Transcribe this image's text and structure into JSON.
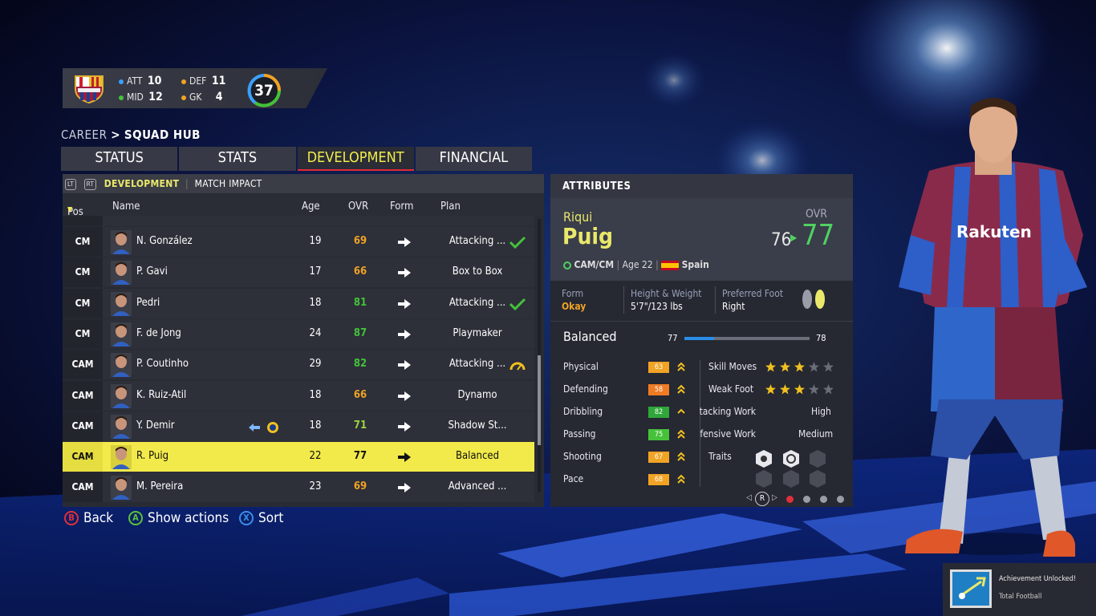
{
  "club": {
    "counts": [
      {
        "label": "ATT",
        "value": "10",
        "color": "#3aa0ff"
      },
      {
        "label": "DEF",
        "value": "11",
        "color": "#f0a325"
      },
      {
        "label": "MID",
        "value": "12",
        "color": "#44c23a"
      },
      {
        "label": "GK",
        "value": "4",
        "color": "#f0a325"
      }
    ],
    "total": "37"
  },
  "breadcrumb": {
    "root": "CAREER",
    "separator": ">",
    "current": "SQUAD HUB"
  },
  "tabs": [
    "STATUS",
    "STATS",
    "DEVELOPMENT",
    "FINANCIAL"
  ],
  "active_tab": "DEVELOPMENT",
  "subtabs": {
    "left_key": "LT",
    "right_key": "RT",
    "active": "DEVELOPMENT",
    "separator": "|",
    "other": "MATCH IMPACT"
  },
  "columns": {
    "pos": "Pos",
    "name": "Name",
    "age": "Age",
    "ovr": "OVR",
    "form": "Form",
    "plan": "Plan"
  },
  "players": [
    {
      "pos": "CM",
      "name": "N. González",
      "age": "19",
      "ovr": "69",
      "ovr_color": "org",
      "plan": "Attacking ...",
      "mark": "check"
    },
    {
      "pos": "CM",
      "name": "P. Gavi",
      "age": "17",
      "ovr": "66",
      "ovr_color": "org",
      "plan": "Box to Box",
      "mark": ""
    },
    {
      "pos": "CM",
      "name": "Pedri",
      "age": "18",
      "ovr": "81",
      "ovr_color": "grn",
      "plan": "Attacking ...",
      "mark": "check"
    },
    {
      "pos": "CM",
      "name": "F. de Jong",
      "age": "24",
      "ovr": "87",
      "ovr_color": "grn",
      "plan": "Playmaker",
      "mark": ""
    },
    {
      "pos": "CAM",
      "name": "P. Coutinho",
      "age": "29",
      "ovr": "82",
      "ovr_color": "grn",
      "plan": "Attacking ...",
      "mark": "gauge"
    },
    {
      "pos": "CAM",
      "name": "K. Ruiz-Atil",
      "age": "18",
      "ovr": "66",
      "ovr_color": "org",
      "plan": "Dynamo",
      "mark": ""
    },
    {
      "pos": "CAM",
      "name": "Y. Demir",
      "age": "18",
      "ovr": "71",
      "ovr_color": "lgrn",
      "plan": "Shadow St...",
      "mark": "loan"
    },
    {
      "pos": "CAM",
      "name": "R. Puig",
      "age": "22",
      "ovr": "77",
      "ovr_color": "lgrn",
      "plan": "Balanced",
      "mark": "",
      "selected": true
    },
    {
      "pos": "CAM",
      "name": "M. Pereira",
      "age": "23",
      "ovr": "69",
      "ovr_color": "org",
      "plan": "Advanced ...",
      "mark": ""
    }
  ],
  "buttons": [
    {
      "key": "B",
      "label": "Back",
      "color": "#e0303a"
    },
    {
      "key": "A",
      "label": "Show actions",
      "color": "#59c23a"
    },
    {
      "key": "X",
      "label": "Sort",
      "color": "#3a8ee8"
    }
  ],
  "attributes": {
    "header": "ATTRIBUTES",
    "first_name": "Riqui",
    "last_name": "Puig",
    "ovr_label": "OVR",
    "ovr_from": "76",
    "ovr_to": "77",
    "position": "CAM/CM",
    "age": "Age 22",
    "nation": "Spain",
    "form_label": "Form",
    "form_value": "Okay",
    "hw_label": "Height & Weight",
    "hw_value": "5'7\"/123 lbs",
    "foot_label": "Preferred Foot",
    "foot_value": "Right",
    "plan_name": "Balanced",
    "plan_from": "77",
    "plan_to": "78",
    "plan_progress": 0.24,
    "stats": [
      {
        "name": "Physical",
        "value": "63",
        "color": "#f0a325"
      },
      {
        "name": "Defending",
        "value": "58",
        "color": "#f07b25"
      },
      {
        "name": "Dribbling",
        "value": "82",
        "color": "#2fa83a"
      },
      {
        "name": "Passing",
        "value": "75",
        "color": "#46c23a"
      },
      {
        "name": "Shooting",
        "value": "67",
        "color": "#f0a325"
      },
      {
        "name": "Pace",
        "value": "68",
        "color": "#f0a325"
      }
    ],
    "skill_moves_label": "Skill Moves",
    "skill_moves": 3,
    "weak_foot_label": "Weak Foot",
    "weak_foot": 3,
    "att_work_label": "Attacking Work",
    "att_work": "High",
    "def_work_label": "Defensive Work",
    "def_work": "Medium",
    "traits_label": "Traits",
    "pager_key": "R"
  },
  "achievement": {
    "title": "Achievement Unlocked!",
    "name": "Total Football"
  }
}
